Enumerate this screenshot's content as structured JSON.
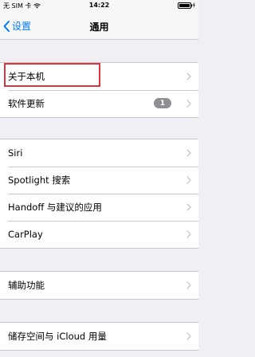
{
  "status_bar": {
    "carrier": "无 SIM 卡",
    "time": "14:22"
  },
  "nav": {
    "back_label": "设置",
    "title": "通用"
  },
  "groups": [
    {
      "items": [
        {
          "label": "关于本机"
        },
        {
          "label": "软件更新",
          "badge": "1"
        }
      ]
    },
    {
      "items": [
        {
          "label": "Siri"
        },
        {
          "label": "Spotlight 搜索"
        },
        {
          "label": "Handoff 与建议的应用"
        },
        {
          "label": "CarPlay"
        }
      ]
    },
    {
      "items": [
        {
          "label": "辅助功能"
        }
      ]
    },
    {
      "items": [
        {
          "label": "储存空间与 iCloud 用量"
        }
      ]
    }
  ],
  "colors": {
    "accent": "#007aff",
    "highlight": "#d9333f",
    "badge": "#8e8e93"
  }
}
